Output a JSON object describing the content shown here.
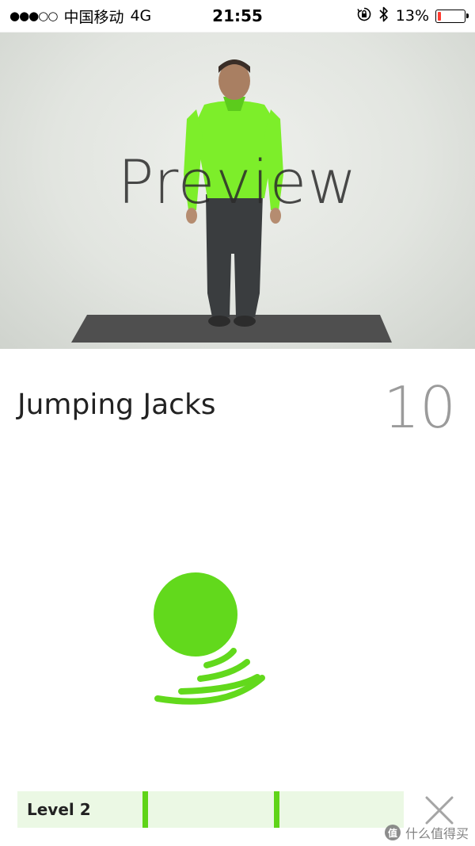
{
  "status_bar": {
    "signal": "●●●○○",
    "carrier": "中国移动",
    "network": "4G",
    "time": "21:55",
    "orientation_lock_icon": "orientation-lock-icon",
    "bluetooth_icon": "bluetooth-icon",
    "battery_percent": "13%",
    "battery_level": 0.13,
    "battery_color": "#ff3b30"
  },
  "video": {
    "overlay_label": "Preview"
  },
  "exercise": {
    "name": "Jumping Jacks",
    "count": "10"
  },
  "icon": {
    "name": "bounce-icon",
    "color": "#62d91c"
  },
  "level": {
    "label": "Level 2",
    "markers": [
      0.33,
      0.67
    ],
    "background": "#ebf8e4",
    "marker_color": "#5fd418"
  },
  "close_icon": "close-icon",
  "watermark": {
    "badge": "值",
    "text": "什么值得买"
  }
}
